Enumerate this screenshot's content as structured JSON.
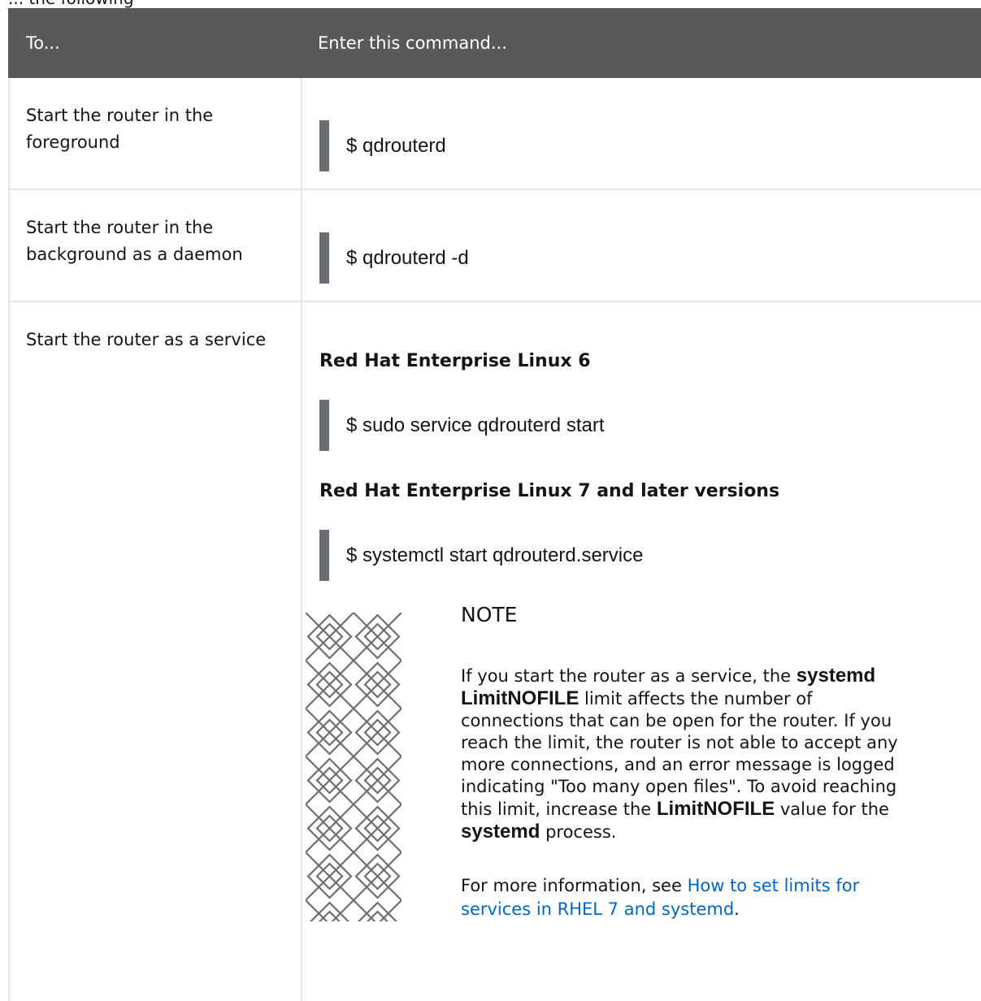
{
  "caption_fragment": "... the following",
  "table": {
    "headers": {
      "col1": "To...",
      "col2": "Enter this command..."
    },
    "rows": [
      {
        "task": "Start the router in the foreground",
        "command": "$ qdrouterd"
      },
      {
        "task": "Start the router in the background as a daemon",
        "command": "$ qdrouterd -d"
      },
      {
        "task": "Start the router as a service",
        "rhel6_heading": "Red Hat Enterprise Linux 6",
        "rhel6_command": "$ sudo service qdrouterd start",
        "rhel7_heading": "Red Hat Enterprise Linux 7 and later versions",
        "rhel7_command": "$ systemctl start qdrouterd.service"
      }
    ]
  },
  "note": {
    "icon": "note-pattern-icon",
    "title": "NOTE",
    "body": {
      "t1": "If you start the router as a service, the ",
      "code1": "systemd LimitNOFILE",
      "t2": " limit affects the number of connections that can be open for the router. If you reach the limit, the router is not able to accept any more connections, and an error message is logged indicating \"Too many open files\". To avoid reaching this limit, increase the ",
      "code2": "LimitNOFILE",
      "t3": " value for the ",
      "code3": "systemd",
      "t4": " process."
    },
    "more_prefix": "For more information, see ",
    "more_link": "How to set limits for services in RHEL 7 and systemd",
    "more_suffix": "."
  },
  "colors": {
    "header_bg": "#595959",
    "header_text": "#ffffff",
    "code_bar": "#6a6e73",
    "border": "#e6e6e6",
    "link": "#0066cc"
  }
}
